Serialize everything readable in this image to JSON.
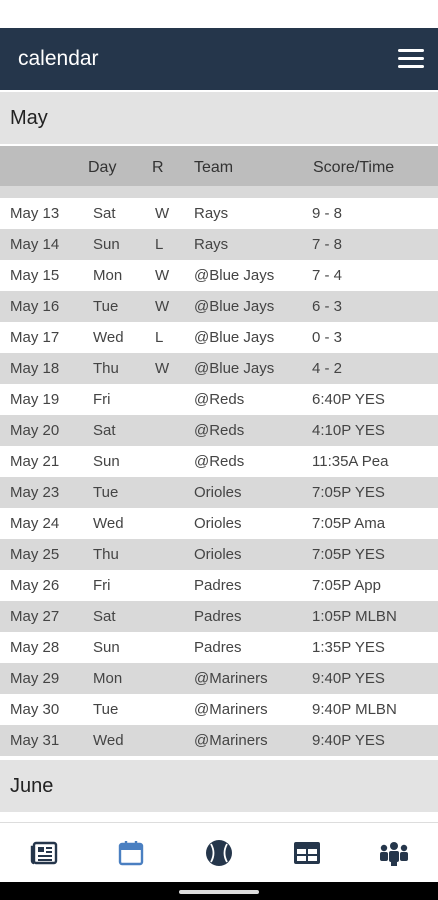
{
  "app": {
    "title": "calendar"
  },
  "sections": {
    "may": "May",
    "june": "June"
  },
  "columns": {
    "date": "",
    "day": "Day",
    "result": "R",
    "team": "Team",
    "score": "Score/Time"
  },
  "games": [
    {
      "date": "May 13",
      "day": "Sat",
      "result": "W",
      "team": "Rays",
      "score": "9 - 8"
    },
    {
      "date": "May 14",
      "day": "Sun",
      "result": "L",
      "team": "Rays",
      "score": "7 - 8"
    },
    {
      "date": "May 15",
      "day": "Mon",
      "result": "W",
      "team": "@Blue Jays",
      "score": "7 - 4"
    },
    {
      "date": "May 16",
      "day": "Tue",
      "result": "W",
      "team": "@Blue Jays",
      "score": "6 - 3"
    },
    {
      "date": "May 17",
      "day": "Wed",
      "result": "L",
      "team": "@Blue Jays",
      "score": "0 - 3"
    },
    {
      "date": "May 18",
      "day": "Thu",
      "result": "W",
      "team": "@Blue Jays",
      "score": "4 - 2"
    },
    {
      "date": "May 19",
      "day": "Fri",
      "result": "",
      "team": "@Reds",
      "score": "6:40P YES"
    },
    {
      "date": "May 20",
      "day": "Sat",
      "result": "",
      "team": "@Reds",
      "score": "4:10P YES"
    },
    {
      "date": "May 21",
      "day": "Sun",
      "result": "",
      "team": "@Reds",
      "score": "11:35A Pea"
    },
    {
      "date": "May 23",
      "day": "Tue",
      "result": "",
      "team": "Orioles",
      "score": "7:05P YES"
    },
    {
      "date": "May 24",
      "day": "Wed",
      "result": "",
      "team": "Orioles",
      "score": "7:05P Ama"
    },
    {
      "date": "May 25",
      "day": "Thu",
      "result": "",
      "team": "Orioles",
      "score": "7:05P YES"
    },
    {
      "date": "May 26",
      "day": "Fri",
      "result": "",
      "team": "Padres",
      "score": "7:05P App"
    },
    {
      "date": "May 27",
      "day": "Sat",
      "result": "",
      "team": "Padres",
      "score": "1:05P MLBN"
    },
    {
      "date": "May 28",
      "day": "Sun",
      "result": "",
      "team": "Padres",
      "score": "1:35P YES"
    },
    {
      "date": "May 29",
      "day": "Mon",
      "result": "",
      "team": "@Mariners",
      "score": "9:40P YES"
    },
    {
      "date": "May 30",
      "day": "Tue",
      "result": "",
      "team": "@Mariners",
      "score": "9:40P MLBN"
    },
    {
      "date": "May 31",
      "day": "Wed",
      "result": "",
      "team": "@Mariners",
      "score": "9:40P YES"
    }
  ],
  "nav": [
    {
      "icon": "news-icon",
      "active": false
    },
    {
      "icon": "calendar-icon",
      "active": true
    },
    {
      "icon": "baseball-icon",
      "active": false
    },
    {
      "icon": "table-icon",
      "active": false
    },
    {
      "icon": "team-icon",
      "active": false
    }
  ],
  "colors": {
    "appbar": "#25364b",
    "active_nav": "#4a7fc1",
    "inactive_nav": "#25364b",
    "row_alt": "#d9d9d9",
    "col_header": "#bdbdbd"
  }
}
